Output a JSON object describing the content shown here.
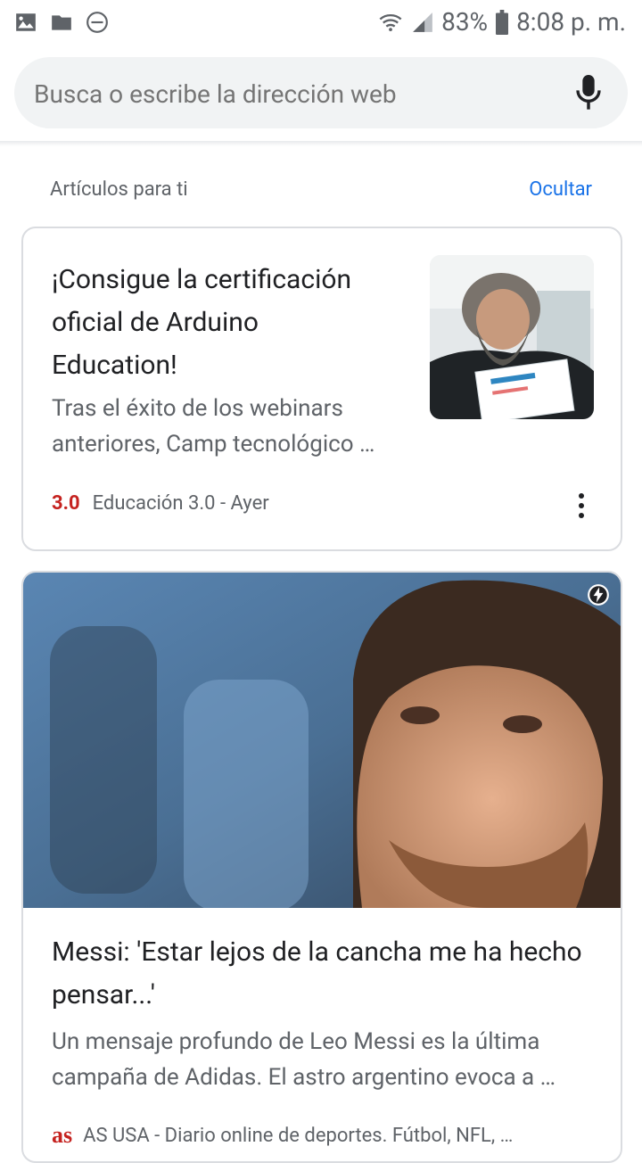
{
  "status_bar": {
    "battery": "83%",
    "time": "8:08 p. m.",
    "icons": [
      "image-icon",
      "folder-icon",
      "dnd-icon",
      "wifi-icon",
      "signal-icon",
      "battery-icon"
    ]
  },
  "search": {
    "placeholder": "Busca o escribe la dirección web",
    "mic_icon": "mic-icon"
  },
  "feed": {
    "section_title": "Artículos para ti",
    "hide_label": "Ocultar"
  },
  "articles": [
    {
      "title": "¡Consigue la certificación oficial de Arduino Education!",
      "snippet": "Tras el éxito de los webinars anteriores, Camp tecnológico …",
      "source_logo": "3.0",
      "source": "Educación 3.0 - Ayer"
    },
    {
      "title": "Messi: 'Estar lejos de la cancha me ha hecho pensar...'",
      "snippet": "Un mensaje profundo de Leo Messi es la última campaña de Adidas. El astro argentino evoca a …",
      "source_logo": "as",
      "source": "AS USA - Diario online de deportes. Fútbol, NFL, …"
    }
  ],
  "colors": {
    "accent": "#1a73e8",
    "source_red": "#c5221f",
    "text_secondary": "#5f6368"
  }
}
